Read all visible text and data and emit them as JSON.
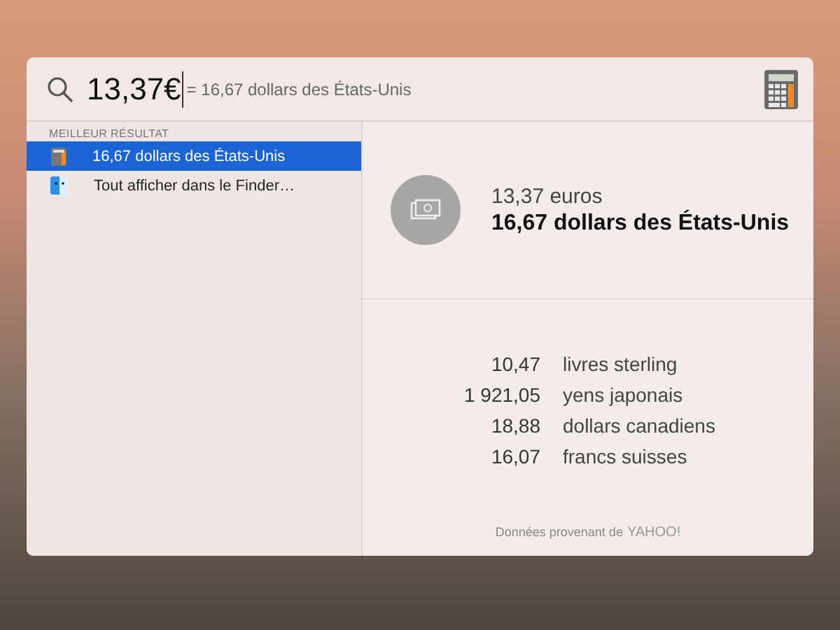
{
  "search": {
    "value": "13,37€",
    "completion": "= 16,67 dollars des États-Unis"
  },
  "results": {
    "section": "MEILLEUR RÉSULTAT",
    "items": [
      {
        "label": "16,67 dollars des États-Unis",
        "kind": "calculator",
        "selected": true
      },
      {
        "label": "Tout afficher dans le Finder…",
        "kind": "finder",
        "selected": false
      }
    ]
  },
  "preview": {
    "source": "13,37 euros",
    "result": "16,67 dollars des États-Unis",
    "conversions": [
      {
        "amount": "10,47",
        "currency": "livres sterling"
      },
      {
        "amount": "1 921,05",
        "currency": "yens japonais"
      },
      {
        "amount": "18,88",
        "currency": "dollars canadiens"
      },
      {
        "amount": "16,07",
        "currency": "francs suisses"
      }
    ],
    "footer": "Données provenant de",
    "provider": "YAHOO!"
  }
}
